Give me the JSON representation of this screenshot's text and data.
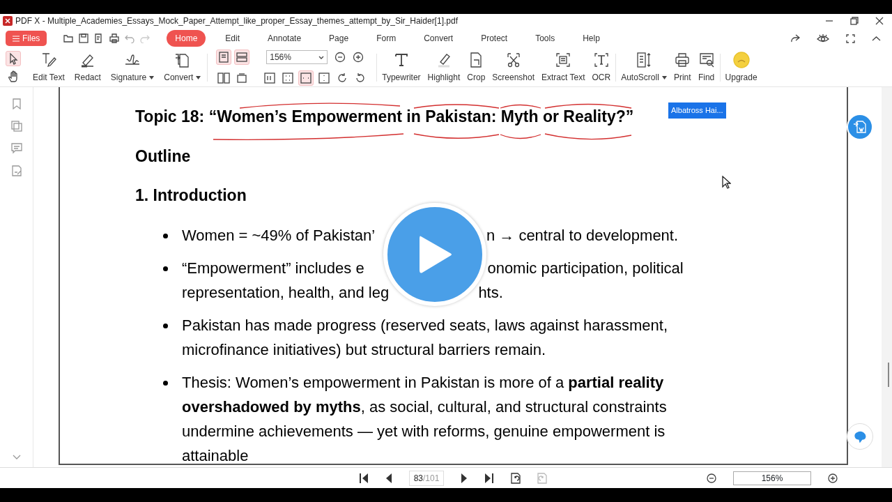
{
  "window": {
    "title": "PDF X - Multiple_Academies_Essays_Mock_Paper_Attempt_like_proper_Essay_themes_attempt_by_Sir_Haider[1].pdf"
  },
  "menu": {
    "files": "Files",
    "tabs": [
      {
        "label": "Home",
        "selected": true
      },
      {
        "label": "Edit",
        "selected": false
      },
      {
        "label": "Annotate",
        "selected": false
      },
      {
        "label": "Page",
        "selected": false
      },
      {
        "label": "Form",
        "selected": false
      },
      {
        "label": "Convert",
        "selected": false
      },
      {
        "label": "Protect",
        "selected": false
      },
      {
        "label": "Tools",
        "selected": false
      },
      {
        "label": "Help",
        "selected": false
      }
    ]
  },
  "toolbar": {
    "cursor_tools": [
      {
        "selected": true
      },
      {
        "selected": false
      }
    ],
    "edit_tools": [
      {
        "label": "Edit Text",
        "dropdown": false
      },
      {
        "label": "Redact",
        "dropdown": false
      },
      {
        "label": "Signature",
        "dropdown": true
      },
      {
        "label": "Convert",
        "dropdown": true
      }
    ],
    "view_buttons": [
      {
        "selected": true
      },
      {
        "selected": true
      },
      {
        "selected": false
      },
      {
        "selected": false
      },
      {
        "selected": false
      },
      {
        "selected": false
      },
      {
        "selected": true
      },
      {
        "selected": false
      },
      {
        "selected": false
      },
      {
        "selected": false
      }
    ],
    "zoom": "156%",
    "page_tools": [
      {
        "label": "Typewriter",
        "dropdown": false
      },
      {
        "label": "Highlight",
        "dropdown": false
      },
      {
        "label": "Crop",
        "dropdown": false
      },
      {
        "label": "Screenshot",
        "dropdown": false
      },
      {
        "label": "Extract Text",
        "dropdown": false
      },
      {
        "label": "OCR",
        "dropdown": false
      },
      {
        "label": "AutoScroll",
        "dropdown": true
      },
      {
        "label": "Print",
        "dropdown": false
      },
      {
        "label": "Find",
        "dropdown": false
      },
      {
        "label": "Upgrade",
        "dropdown": false
      }
    ]
  },
  "document": {
    "heading": "Topic 18: “Women’s Empowerment in Pakistan: Myth or Reality?”",
    "comment_tag": "Albatross Hai...",
    "outline": "Outline",
    "section": "1. Introduction",
    "bullets": [
      {
        "lines": [
          [
            "Women = ~49% of Pakistan’",
            "n → central to development."
          ]
        ]
      },
      {
        "lines": [
          [
            "“Empowerment” includes e",
            "onomic participation, political"
          ],
          [
            "representation, health, and leg",
            "hts."
          ]
        ]
      },
      {
        "lines": [
          [
            "Pakistan has made progress (reserved seats, laws against harassment,"
          ],
          [
            "microfinance initiatives) but structural barriers remain."
          ]
        ]
      },
      {
        "lines": [
          [
            "Thesis: Women’s empowerment in Pakistan is more of a **partial reality**"
          ],
          [
            "**overshadowed by myths**, as social, cultural, and structural constraints"
          ],
          [
            "undermine achievements — yet with reforms, genuine empowerment is"
          ],
          [
            "attainable"
          ]
        ]
      }
    ]
  },
  "navigation": {
    "page": "83",
    "total": "/101",
    "history": [
      {
        "disabled": false
      },
      {
        "disabled": true
      }
    ],
    "zoom": "156%"
  }
}
